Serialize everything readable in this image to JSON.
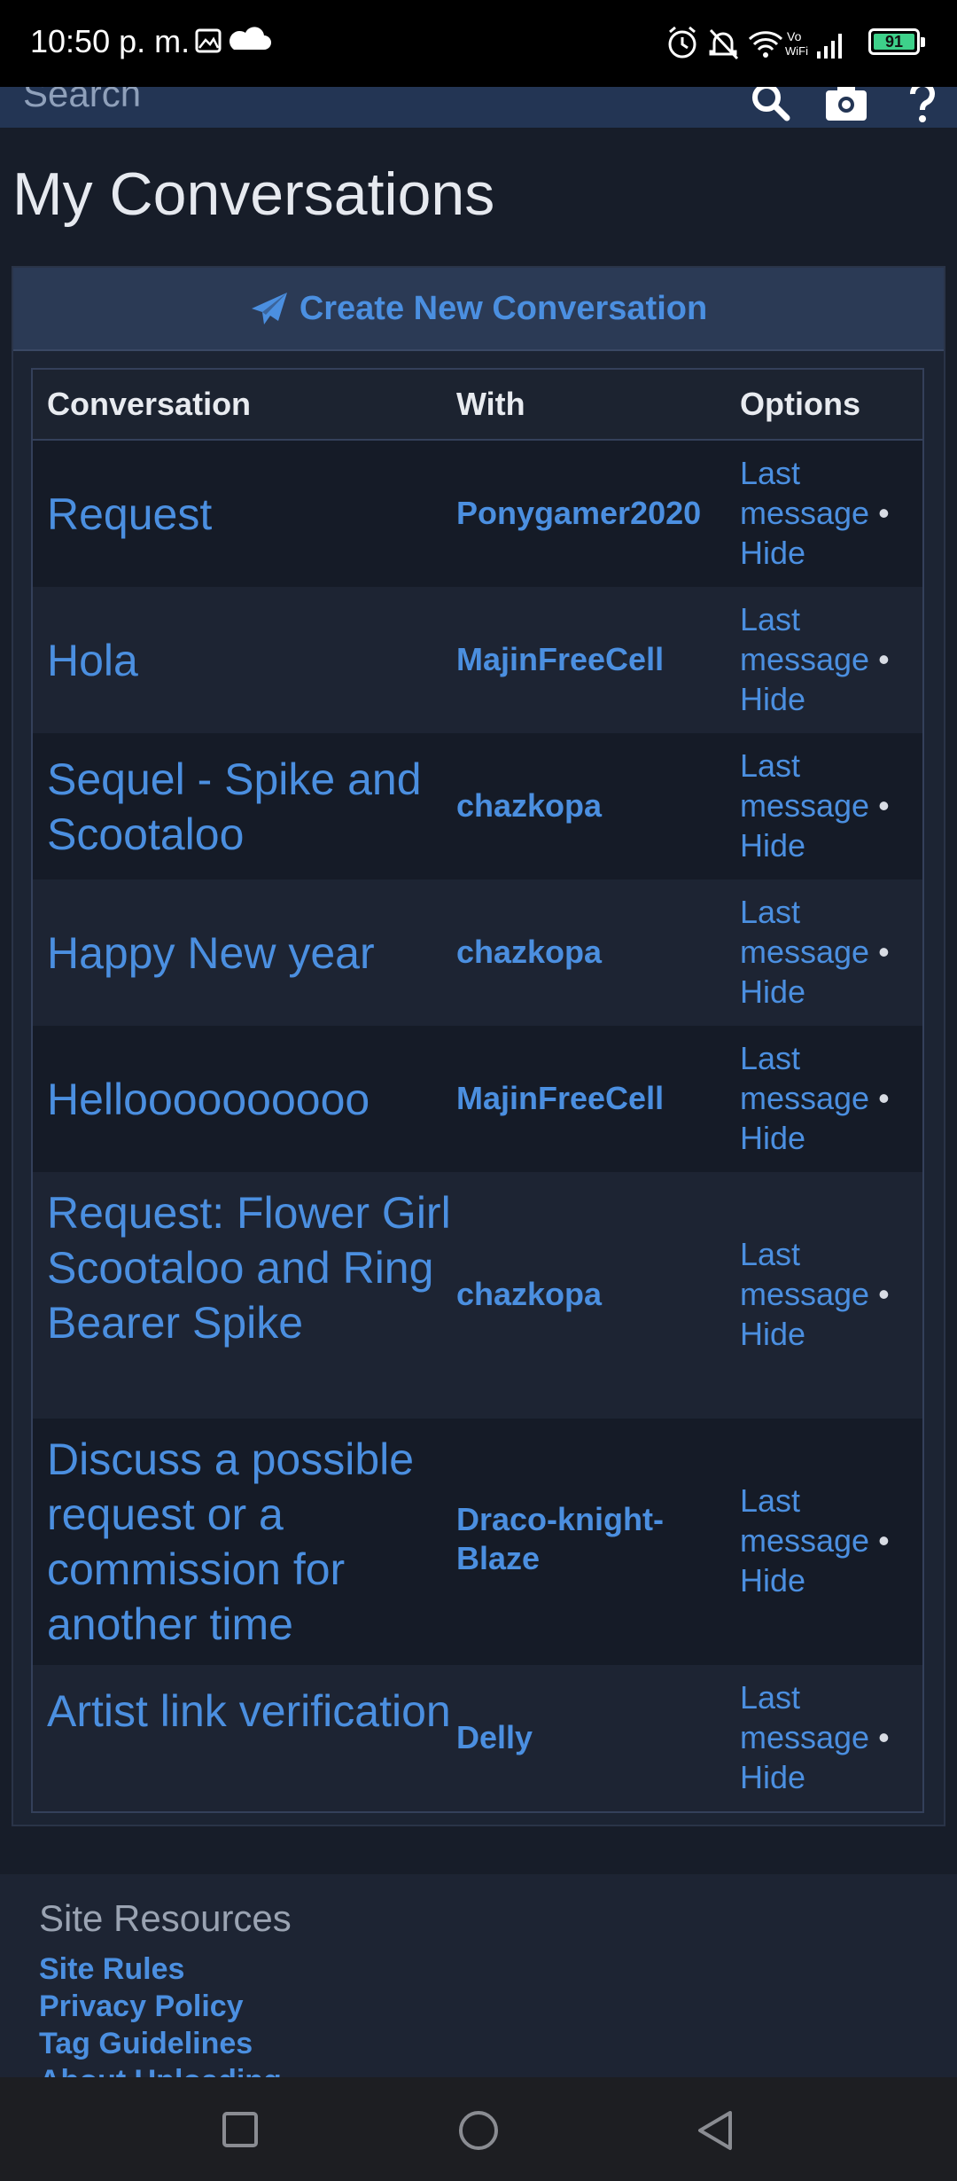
{
  "status_bar": {
    "time": "10:50 p. m.",
    "battery": "91",
    "wifi_label": "Vo WiFi"
  },
  "header": {
    "search_placeholder": "Search"
  },
  "page": {
    "title": "My Conversations",
    "create_button": "Create New Conversation"
  },
  "table": {
    "columns": [
      "Conversation",
      "With",
      "Options"
    ],
    "rows": [
      {
        "title": "Request",
        "with": "Ponygamer2020",
        "opt1": "Last message",
        "sep": "•",
        "opt2": "Hide"
      },
      {
        "title": "Hola",
        "with": "MajinFreeCell",
        "opt1": "Last message",
        "sep": "•",
        "opt2": "Hide"
      },
      {
        "title": "Sequel - Spike and Scootaloo",
        "with": "chazkopa",
        "opt1": "Last message",
        "sep": "•",
        "opt2": "Hide"
      },
      {
        "title": "Happy New year",
        "with": "chazkopa",
        "opt1": "Last message",
        "sep": "•",
        "opt2": "Hide"
      },
      {
        "title": "Helloooooooooo",
        "with": "MajinFreeCell",
        "opt1": "Last message",
        "sep": "•",
        "opt2": "Hide"
      },
      {
        "title": "Request: Flower Girl Scootaloo and Ring Bearer Spike",
        "with": "chazkopa",
        "opt1": "Last message",
        "sep": "•",
        "opt2": "Hide"
      },
      {
        "title": "Discuss a possible request or a commission for another time",
        "with": "Draco-knight-Blaze",
        "opt1": "Last message",
        "sep": "•",
        "opt2": "Hide"
      },
      {
        "title": "Artist link verification",
        "with": "Delly",
        "opt1": "Last message",
        "sep": "•",
        "opt2": "Hide"
      }
    ]
  },
  "footer": {
    "heading": "Site Resources",
    "links": [
      "Site Rules",
      "Privacy Policy",
      "Tag Guidelines",
      "About Uploading"
    ]
  },
  "colors": {
    "link": "#4b8fe0",
    "background": "#171d29",
    "header_bar": "#233554"
  }
}
